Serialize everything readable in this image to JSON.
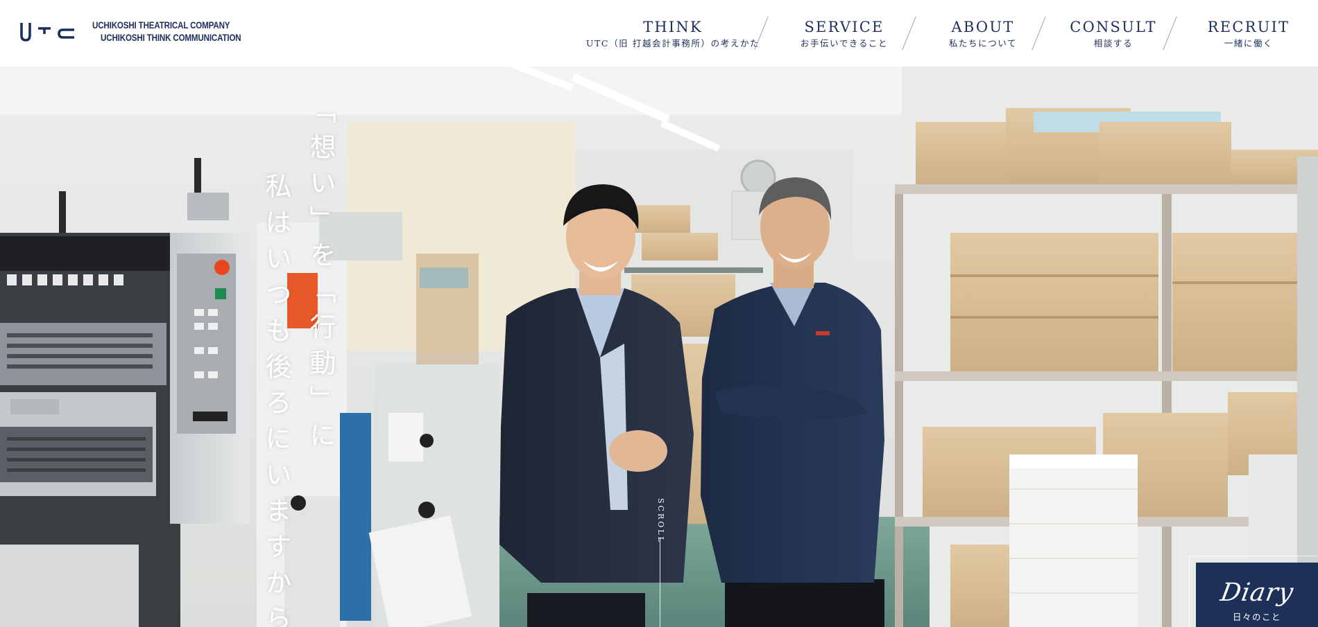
{
  "brand": {
    "line1": "UCHIKOSHI THEATRICAL COMPANY",
    "line2": "UCHIKOSHI THINK COMMUNICATION",
    "navy": "#1c2f5c"
  },
  "nav": [
    {
      "en": "THINK",
      "ja": "UTC（旧 打越会計事務所）の考えかた"
    },
    {
      "en": "SERVICE",
      "ja": "お手伝いできること"
    },
    {
      "en": "ABOUT",
      "ja": "私たちについて"
    },
    {
      "en": "CONSULT",
      "ja": "相談する"
    },
    {
      "en": "RECRUIT",
      "ja": "一緒に働く"
    }
  ],
  "hero": {
    "catch_line1": "「想い」を「行動」に",
    "catch_line2": "私はいつも後ろにいますから",
    "scroll_label": "SCROLL",
    "icons": {
      "scene": "print-shop-photo",
      "press_logo": "PMP"
    }
  },
  "diary": {
    "title": "Diary",
    "subtitle": "日々のこと",
    "color": "#1d3158"
  }
}
